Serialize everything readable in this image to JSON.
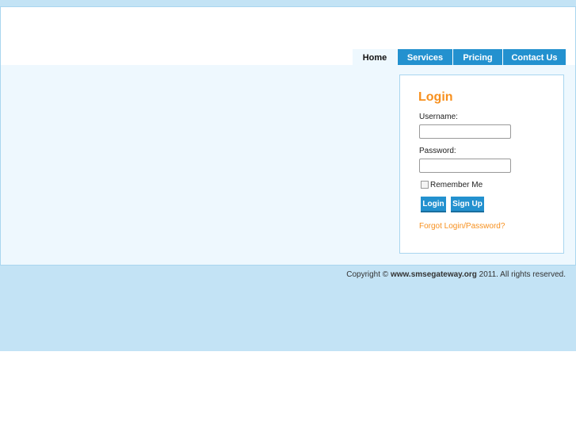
{
  "nav": {
    "tabs": [
      {
        "label": "Home"
      },
      {
        "label": "Services"
      },
      {
        "label": "Pricing"
      },
      {
        "label": "Contact Us"
      }
    ]
  },
  "login": {
    "title": "Login",
    "username_label": "Username:",
    "username_value": "",
    "password_label": "Password:",
    "password_value": "",
    "remember_label": "Remember Me",
    "login_button": "Login",
    "signup_button": "Sign Up",
    "forgot_link": "Forgot Login/Password?"
  },
  "footer": {
    "prefix": "Copyright ©",
    "site": "www.smsegateway.org",
    "suffix": "2011. All rights reserved."
  },
  "colors": {
    "accent": "#2391cf",
    "orange": "#f7901e",
    "band": "#c3e3f5"
  }
}
